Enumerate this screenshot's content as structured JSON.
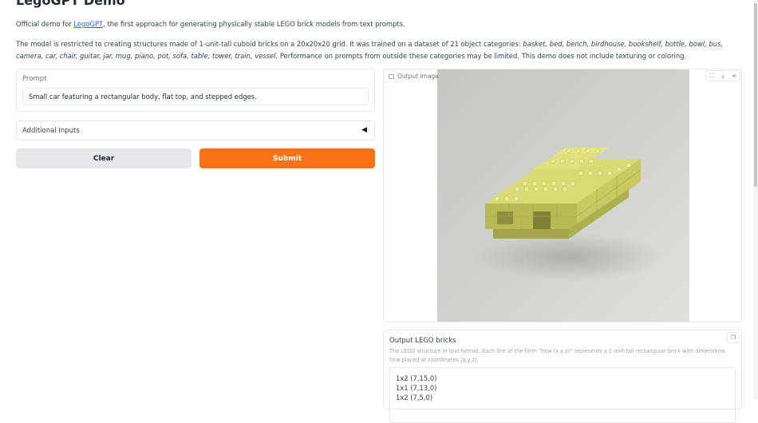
{
  "header": {
    "title": "LegoGPT Demo",
    "intro_prefix": "Official demo for ",
    "intro_link": "LegoGPT",
    "intro_suffix": ", the first approach for generating physically stable LEGO brick models from text prompts."
  },
  "description": {
    "text_before": "The model is restricted to creating structures made of 1-unit-tall cuboid bricks on a 20x20x20 grid. It was trained on a dataset of 21 object categories: ",
    "categories": "basket, bed, bench, birdhouse, bookshelf, bottle, bowl, bus, camera, car, chair, guitar, jar, mug, piano, pot, sofa, table, tower, train, vessel.",
    "text_after": " Performance on prompts from outside these categories may be limited. This demo does not include texturing or coloring."
  },
  "prompt": {
    "label": "Prompt",
    "value": "Small car featuring a rectangular body, flat top, and stepped edges."
  },
  "accordion": {
    "label": "Additional Inputs",
    "arrow": "◀"
  },
  "buttons": {
    "clear": "Clear",
    "submit": "Submit"
  },
  "output_image": {
    "label": "Output image",
    "icons": [
      "fullscreen-icon",
      "download-icon",
      "share-icon"
    ],
    "model_color": "#d5d66a",
    "background_color": "#c9cbc6"
  },
  "output_bricks": {
    "label": "Output LEGO bricks",
    "info": "The LEGO structure in text format. Each line of the form \"hxw (x,y,z)\" represents a 1-unit-tall rectangular brick with dimensions hxw placed at coordinates (x,y,z).",
    "lines": [
      "1x2 (7,15,0)",
      "1x1 (7,13,0)",
      "1x2 (7,5,0)"
    ]
  },
  "colors": {
    "accent": "#f97316",
    "link": "#2563eb"
  }
}
